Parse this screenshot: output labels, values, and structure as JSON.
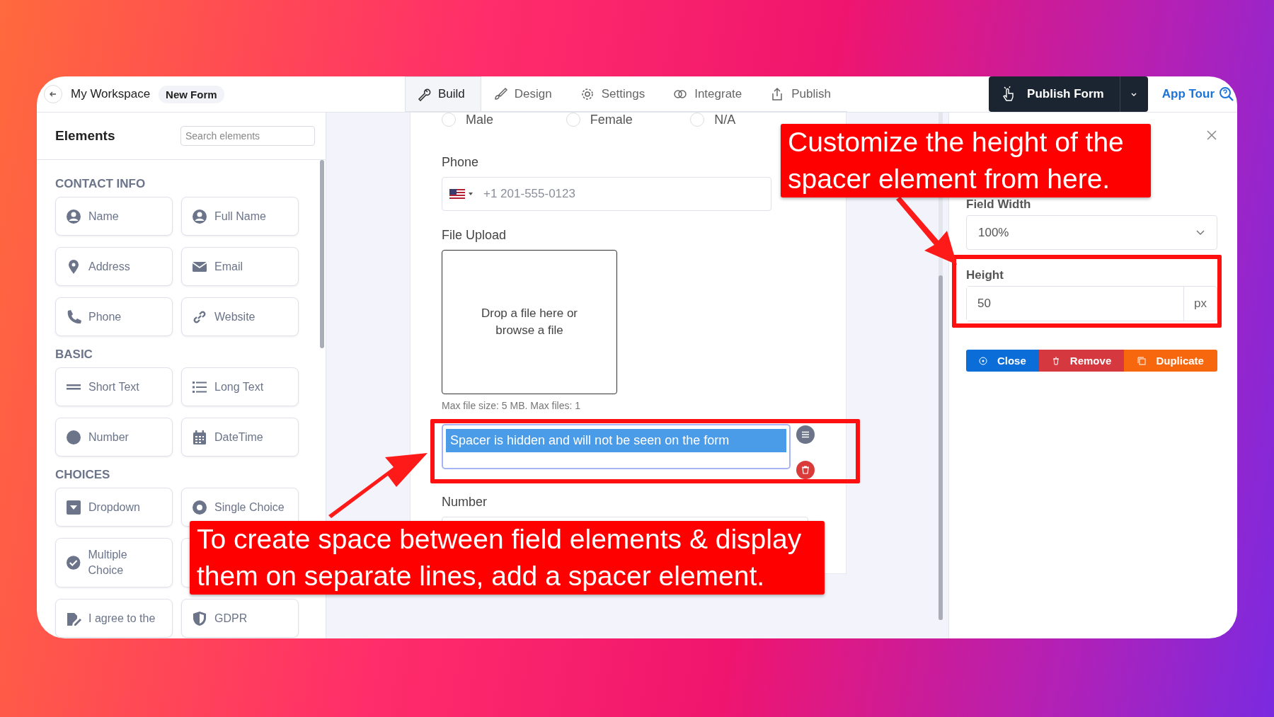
{
  "top_bar": {
    "workspace": "My Workspace",
    "form_name": "New Form",
    "tabs": [
      {
        "label": "Build",
        "selected": true
      },
      {
        "label": "Design",
        "selected": false
      },
      {
        "label": "Settings",
        "selected": false
      },
      {
        "label": "Integrate",
        "selected": false
      },
      {
        "label": "Publish",
        "selected": false
      }
    ],
    "publish_button": "Publish Form",
    "app_tour": "App Tour"
  },
  "elements_panel": {
    "title": "Elements",
    "search": {
      "placeholder": "Search elements"
    },
    "groups": [
      {
        "title": "CONTACT INFO",
        "items": [
          {
            "label": "Name"
          },
          {
            "label": "Full Name"
          },
          {
            "label": "Address"
          },
          {
            "label": "Email"
          },
          {
            "label": "Phone"
          },
          {
            "label": "Website"
          }
        ]
      },
      {
        "title": "BASIC",
        "items": [
          {
            "label": "Short Text"
          },
          {
            "label": "Long Text"
          },
          {
            "label": "Number"
          },
          {
            "label": "DateTime"
          }
        ]
      },
      {
        "title": "CHOICES",
        "items": [
          {
            "label": "Dropdown"
          },
          {
            "label": "Single Choice"
          },
          {
            "label": "Multiple Choice"
          },
          {
            "kind": "covered"
          },
          {
            "label": "I agree to the"
          },
          {
            "label": "GDPR"
          }
        ]
      }
    ]
  },
  "form": {
    "radio_options": [
      {
        "label": "Male",
        "selected": false
      },
      {
        "label": "Female",
        "selected": false
      },
      {
        "label": "N/A",
        "selected": false
      }
    ],
    "phone": {
      "label": "Phone",
      "placeholder": "+1 201-555-0123"
    },
    "file_upload": {
      "label": "File Upload",
      "prompt": "Drop a file here or browse a file",
      "hint": "Max file size: 5 MB. Max files: 1"
    },
    "spacer": {
      "message": "Spacer is hidden and will not be seen on the form"
    },
    "number": {
      "label": "Number"
    }
  },
  "settings_panel": {
    "field_width": {
      "label": "Field Width",
      "value": "100%"
    },
    "height": {
      "label": "Height",
      "value": "50",
      "unit": "px"
    },
    "buttons": [
      "Close",
      "Remove",
      "Duplicate"
    ]
  },
  "annotations": [
    {
      "lines": [
        "Customize the height of the",
        "spacer element from here."
      ]
    },
    {
      "lines": [
        "To create space between field elements & display",
        "them on separate lines, add a spacer element."
      ]
    }
  ]
}
